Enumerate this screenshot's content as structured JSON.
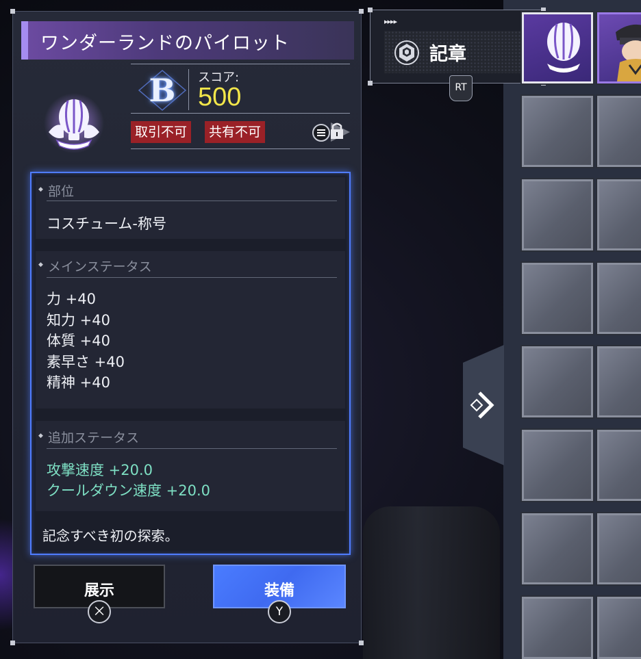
{
  "item": {
    "name": "ワンダーランドのパイロット",
    "grade": "B",
    "score_label": "スコア:",
    "score": "500",
    "tags": [
      "取引不可",
      "共有不可"
    ],
    "icon": "hot-air-balloon-badge-icon"
  },
  "sections": {
    "slot": {
      "header": "部位",
      "value": "コスチューム-称号"
    },
    "main_stats": {
      "header": "メインステータス",
      "lines": [
        "力 +40",
        "知力 +40",
        "体質 +40",
        "素早さ +40",
        "精神 +40"
      ]
    },
    "extra_stats": {
      "header": "追加ステータス",
      "lines": [
        "攻撃速度 +20.0",
        "クールダウン速度 +20.0"
      ]
    },
    "description": "記念すべき初の探索。"
  },
  "buttons": {
    "show": {
      "label": "展示",
      "key": "⨉"
    },
    "equip": {
      "label": "装備",
      "key": "Y"
    }
  },
  "category": {
    "label": "記章",
    "arrows": "▸▸▸▸",
    "shoulder_key": "RT"
  },
  "colors": {
    "accent_blue": "#4f7cff",
    "score_yellow": "#f2e64a",
    "tag_red": "#9a2127",
    "stat_green": "#7ee0c4",
    "title_purple": "#6b4aa0"
  }
}
